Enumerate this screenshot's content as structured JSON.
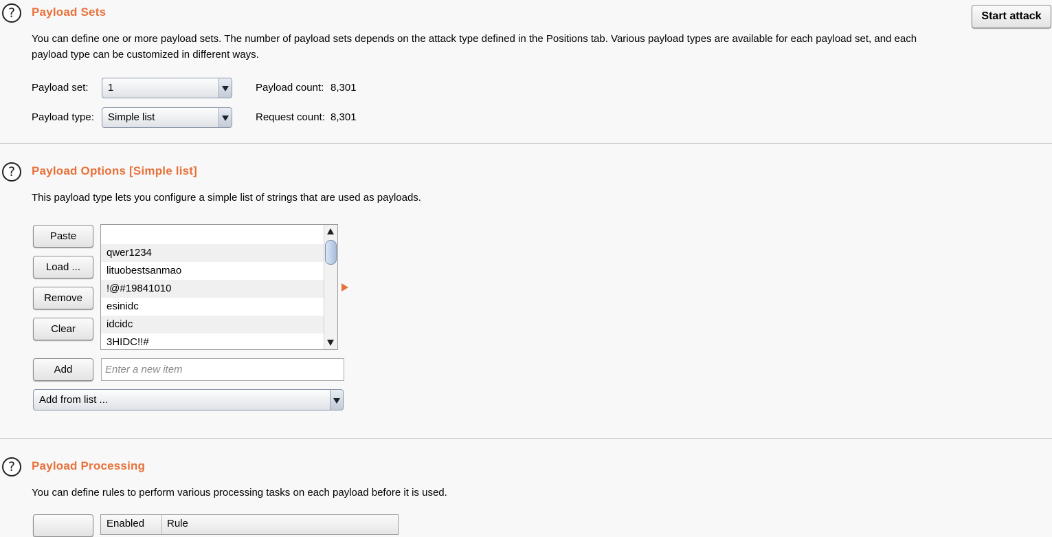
{
  "payload_sets": {
    "title": "Payload Sets",
    "description_line1": "You can define one or more payload sets. The number of payload sets depends on the attack type defined in the Positions tab. Various payload types are available for each payload set, and each",
    "description_line2": "payload type can be customized in different ways.",
    "start_attack_label": "Start attack",
    "payload_set_label": "Payload set:",
    "payload_set_value": "1",
    "payload_type_label": "Payload type:",
    "payload_type_value": "Simple list",
    "payload_count_label": "Payload count:",
    "payload_count_value": "8,301",
    "request_count_label": "Request count:",
    "request_count_value": "8,301"
  },
  "payload_options": {
    "title": "Payload Options [Simple list]",
    "description": "This payload type lets you configure a simple list of strings that are used as payloads.",
    "buttons": {
      "paste": "Paste",
      "load": "Load ...",
      "remove": "Remove",
      "clear": "Clear",
      "add": "Add"
    },
    "list_items": [
      "",
      "qwer1234",
      "lituobestsanmao",
      "!@#19841010",
      "esinidc",
      "idcidc",
      "3HIDC!!#"
    ],
    "add_placeholder": "Enter a new item",
    "add_from_list_label": "Add from list ..."
  },
  "payload_processing": {
    "title": "Payload Processing",
    "description": "You can define rules to perform various processing tasks on each payload before it is used.",
    "columns": [
      "Enabled",
      "Rule"
    ]
  },
  "colors": {
    "section_title": "#e8713a",
    "background": "#f8f8f8"
  }
}
